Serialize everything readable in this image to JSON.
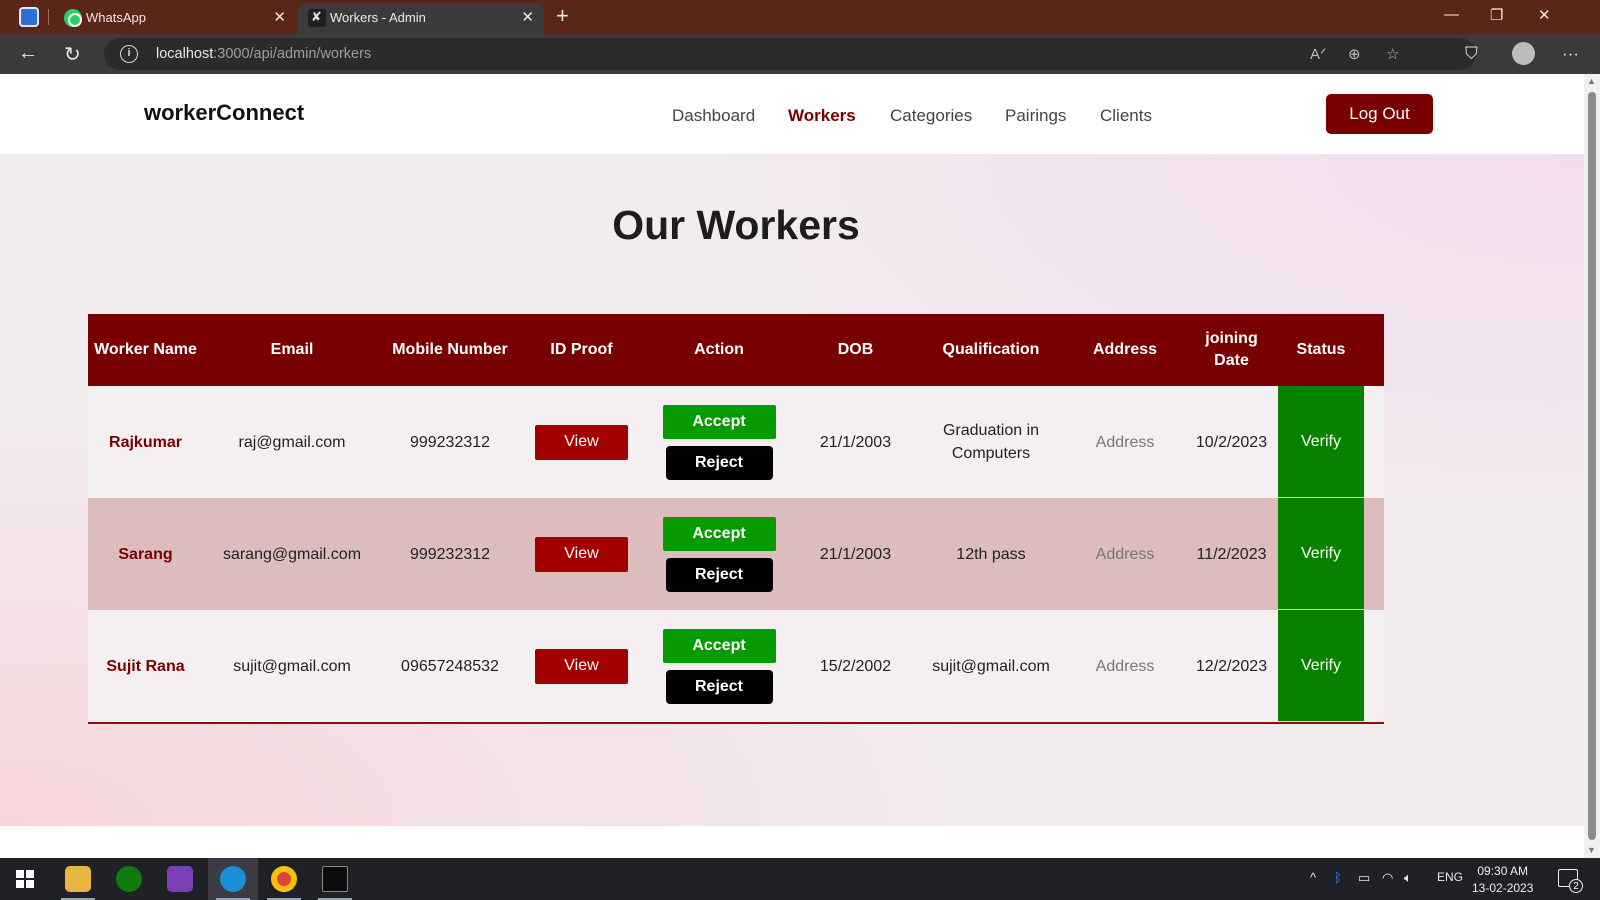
{
  "browser": {
    "tabs": [
      {
        "title": "WhatsApp",
        "close": "✕"
      },
      {
        "title": "Workers - Admin",
        "close": "✕"
      }
    ],
    "new_tab": "+",
    "window_controls": {
      "minimize": "—",
      "restore": "❐",
      "close": "✕"
    },
    "url_host": "localhost",
    "url_path": ":3000/api/admin/workers",
    "nav": {
      "back": "←",
      "reload": "↻",
      "info": "i",
      "more": "···"
    }
  },
  "site": {
    "brand": "workerConnect",
    "nav": [
      "Dashboard",
      "Workers",
      "Categories",
      "Pairings",
      "Clients"
    ],
    "active_nav": "Workers",
    "logout": "Log Out"
  },
  "page_title": "Our Workers",
  "table": {
    "headers": {
      "name": "Worker Name",
      "email": "Email",
      "mobile": "Mobile Number",
      "id_proof": "ID Proof",
      "action": "Action",
      "dob": "DOB",
      "qualification": "Qualification",
      "address": "Address",
      "joining": "joining Date",
      "status": "Status"
    },
    "button_labels": {
      "view": "View",
      "accept": "Accept",
      "reject": "Reject"
    },
    "rows": [
      {
        "name": "Rajkumar",
        "email": "raj@gmail.com",
        "mobile": "999232312",
        "dob": "21/1/2003",
        "qualification": "Graduation in Computers",
        "address": "Address",
        "joining": "10/2/2023",
        "status": "Verify"
      },
      {
        "name": "Sarang",
        "email": "sarang@gmail.com",
        "mobile": "999232312",
        "dob": "21/1/2003",
        "qualification": "12th pass",
        "address": "Address",
        "joining": "11/2/2023",
        "status": "Verify"
      },
      {
        "name": "Sujit Rana",
        "email": "sujit@gmail.com",
        "mobile": "09657248532",
        "dob": "15/2/2002",
        "qualification": "sujit@gmail.com",
        "address": "Address",
        "joining": "12/2/2023",
        "status": "Verify"
      }
    ]
  },
  "taskbar": {
    "tray_lang": "ENG",
    "time": "09:30 AM",
    "date": "13-02-2023",
    "notification_count": "2"
  },
  "colors": {
    "brand_maroon": "#780000",
    "accept_green": "#089b00",
    "status_green": "#078200",
    "view_red": "#a30000",
    "alt_row": "#dcbcbd"
  }
}
